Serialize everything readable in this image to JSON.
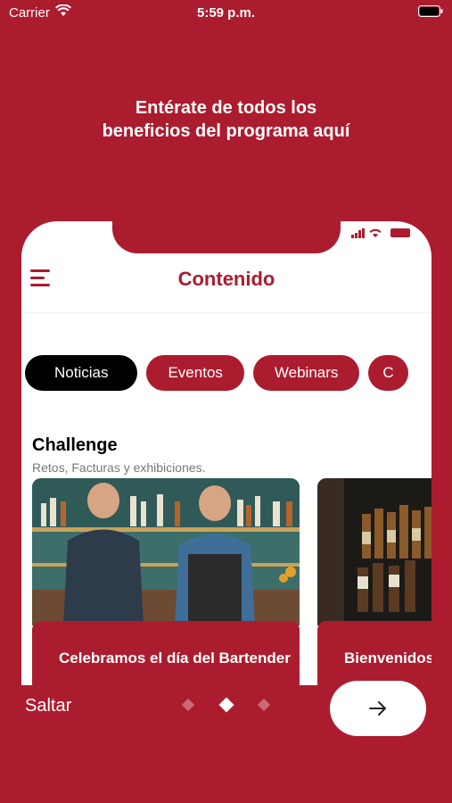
{
  "status_bar": {
    "carrier": "Carrier",
    "time": "5:59 p.m."
  },
  "headline": "Entérate de todos los beneficios del programa aquí",
  "phone": {
    "title": "Contenido",
    "tabs": [
      {
        "label": "Noticias",
        "active": true
      },
      {
        "label": "Eventos",
        "active": false
      },
      {
        "label": "Webinars",
        "active": false
      },
      {
        "label": "C",
        "active": false
      }
    ],
    "section": {
      "title": "Challenge",
      "subtitle": "Retos, Facturas y exhibiciones."
    },
    "cards": [
      {
        "caption": "Celebramos el día del Bartender"
      },
      {
        "caption": "Bienvenidos"
      }
    ]
  },
  "footer": {
    "skip_label": "Saltar",
    "pagination": {
      "total": 3,
      "current": 2
    }
  },
  "colors": {
    "brand": "#ac1c2f",
    "chip_active": "#000000"
  },
  "icons": [
    "wifi-icon",
    "battery-icon",
    "menu-icon",
    "arrow-right-icon",
    "cellular-signal-icon"
  ]
}
